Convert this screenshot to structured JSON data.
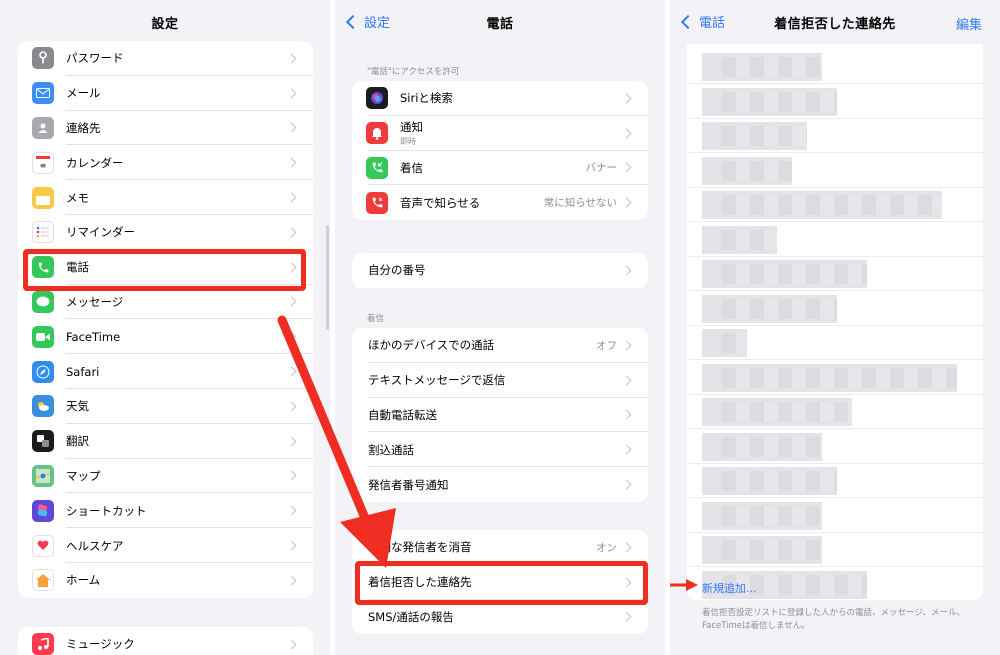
{
  "colors": {
    "accent": "#3478f6",
    "highlight": "#ef2d22",
    "bg": "#f2f2f7"
  },
  "settings": {
    "title": "設定",
    "items": [
      {
        "label": "パスワード",
        "icon": "key-icon",
        "color": "#8a8a8e"
      },
      {
        "label": "メール",
        "icon": "mail-icon",
        "color": "#3a8ef5"
      },
      {
        "label": "連絡先",
        "icon": "contacts-icon",
        "color": "#a9a9ad"
      },
      {
        "label": "カレンダー",
        "icon": "calendar-icon",
        "color": "#ffffff"
      },
      {
        "label": "メモ",
        "icon": "notes-icon",
        "color": "#f7c944"
      },
      {
        "label": "リマインダー",
        "icon": "reminders-icon",
        "color": "#ffffff"
      },
      {
        "label": "電話",
        "icon": "phone-icon",
        "color": "#34c759"
      },
      {
        "label": "メッセージ",
        "icon": "messages-icon",
        "color": "#34c759"
      },
      {
        "label": "FaceTime",
        "icon": "facetime-icon",
        "color": "#34c759"
      },
      {
        "label": "Safari",
        "icon": "safari-icon",
        "color": "#2f8cf0"
      },
      {
        "label": "天気",
        "icon": "weather-icon",
        "color": "#3b8de0"
      },
      {
        "label": "翻訳",
        "icon": "translate-icon",
        "color": "#1c1c1e"
      },
      {
        "label": "マップ",
        "icon": "maps-icon",
        "color": "#68c08a"
      },
      {
        "label": "ショートカット",
        "icon": "shortcuts-icon",
        "color": "#5b4ad8"
      },
      {
        "label": "ヘルスケア",
        "icon": "health-icon",
        "color": "#ffffff"
      },
      {
        "label": "ホーム",
        "icon": "home-icon",
        "color": "#ffffff"
      }
    ],
    "music": {
      "label": "ミュージック",
      "icon": "music-icon",
      "color": "#fa3c4c"
    }
  },
  "phone": {
    "back": "設定",
    "title": "電話",
    "access_header": "\"電話\"にアクセスを許可",
    "access_items": [
      {
        "label": "Siriと検索",
        "sub": "",
        "value": "",
        "icon": "siri-icon",
        "color": "#1c1c1e"
      },
      {
        "label": "通知",
        "sub": "即時",
        "value": "",
        "icon": "notifications-icon",
        "color": "#ef3b3b"
      },
      {
        "label": "着信",
        "sub": "",
        "value": "バナー",
        "icon": "incoming-call-icon",
        "color": "#34c759"
      },
      {
        "label": "音声で知らせる",
        "sub": "",
        "value": "常に知らせない",
        "icon": "announce-calls-icon",
        "color": "#ef3b3b"
      }
    ],
    "my_number": "自分の番号",
    "calls_header": "着信",
    "call_items": [
      {
        "label": "ほかのデバイスでの通話",
        "value": "オフ"
      },
      {
        "label": "テキストメッセージで返信",
        "value": ""
      },
      {
        "label": "自動電話転送",
        "value": ""
      },
      {
        "label": "割込通話",
        "value": ""
      },
      {
        "label": "発信者番号通知",
        "value": ""
      }
    ],
    "block_items": [
      {
        "label": "不明な発信者を消音",
        "value": "オン"
      },
      {
        "label": "着信拒否した連絡先",
        "value": ""
      },
      {
        "label": "SMS/通話の報告",
        "value": ""
      }
    ]
  },
  "blocked": {
    "back": "電話",
    "title": "着信拒否した連絡先",
    "edit": "編集",
    "add_new": "新規追加...",
    "footnote": "着信拒否設定リストに登録した人からの電話、メッセージ、メール、FaceTimeは着信しません。"
  }
}
